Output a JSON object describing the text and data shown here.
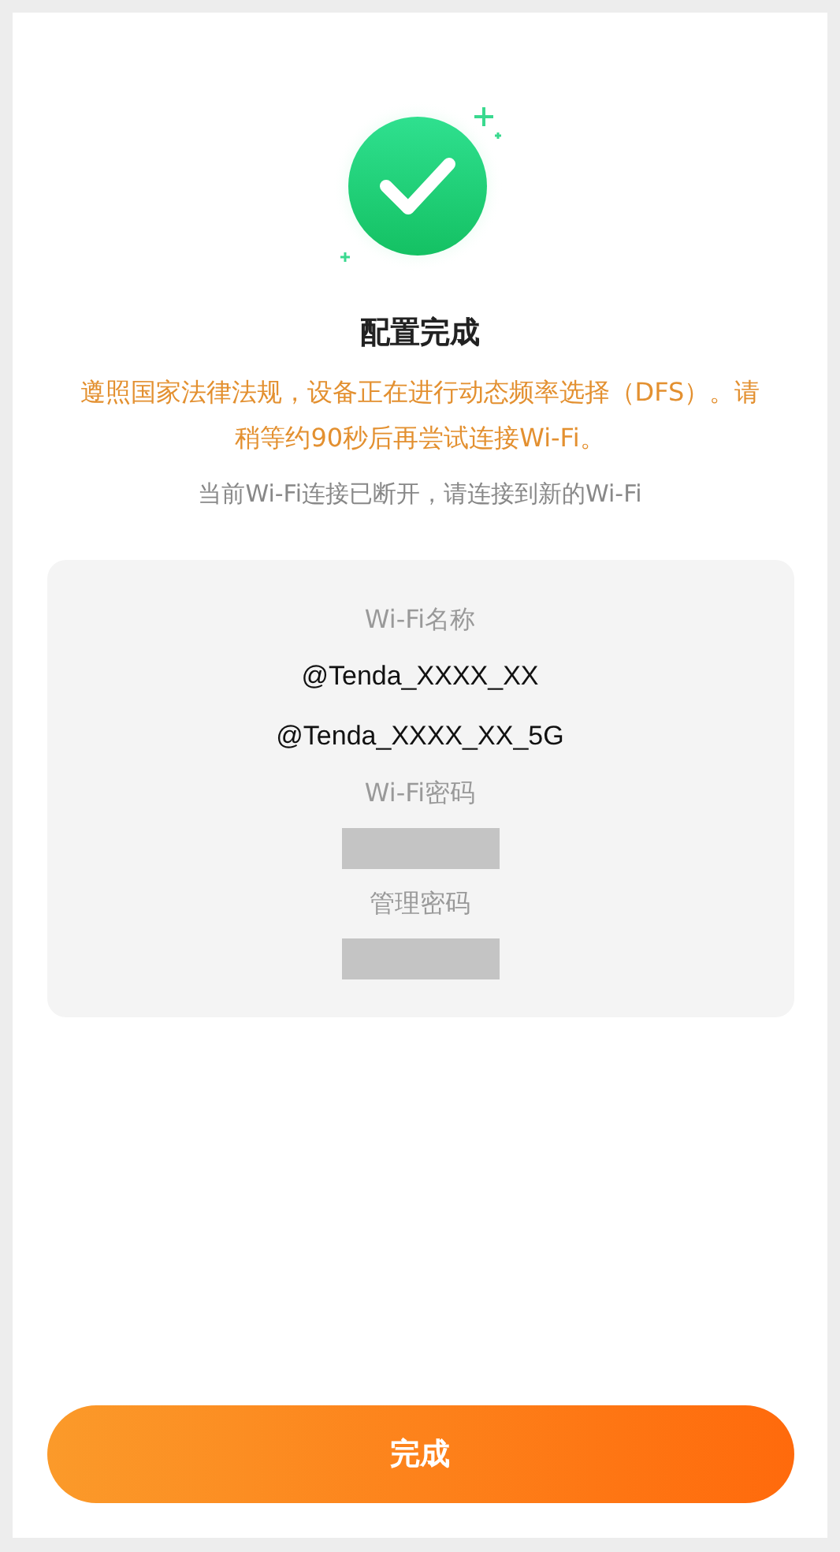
{
  "title": "配置完成",
  "notice": "遵照国家法律法规，设备正在进行动态频率选择（DFS）。请稍等约90秒后再尝试连接Wi-Fi。",
  "hint": "当前Wi-Fi连接已断开，请连接到新的Wi-Fi",
  "info": [
    {
      "kind": "label",
      "text": "Wi-Fi名称"
    },
    {
      "kind": "value",
      "text": "@Tenda_XXXX_XX"
    },
    {
      "kind": "value",
      "text": "@Tenda_XXXX_XX_5G"
    },
    {
      "kind": "label",
      "text": "Wi-Fi密码"
    },
    {
      "kind": "masked"
    },
    {
      "kind": "label",
      "text": "管理密码"
    },
    {
      "kind": "masked"
    }
  ],
  "button": "完成"
}
